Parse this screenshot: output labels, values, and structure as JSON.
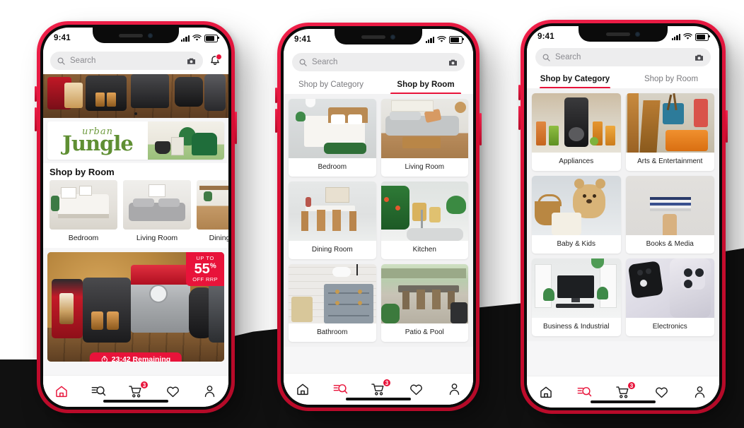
{
  "meta": {
    "accent_red": "#e8133a",
    "bg_top": "#ffffff",
    "bg_bottom": "#111111"
  },
  "status_bar": {
    "time": "9:41",
    "signal_icon": "cellular-signal-icon",
    "wifi_icon": "wifi-icon",
    "battery_icon": "battery-icon"
  },
  "search": {
    "placeholder": "Search",
    "search_icon": "search-icon",
    "camera_icon": "camera-icon",
    "bell_icon": "bell-icon"
  },
  "tabs": {
    "category_label": "Shop by Category",
    "room_label": "Shop by Room"
  },
  "nav": {
    "home_label": "Home",
    "home_icon": "home-icon",
    "search_label": "Search",
    "search_icon": "filter-search-icon",
    "cart_label": "Cart",
    "cart_icon": "cart-icon",
    "cart_badge": "3",
    "wishlist_label": "Wishlist",
    "wishlist_icon": "heart-icon",
    "account_label": "Account",
    "account_icon": "person-icon"
  },
  "phone1": {
    "banner": {
      "urban": "urban",
      "jungle": "Jungle"
    },
    "section_title": "Shop by Room",
    "rooms": [
      {
        "label": "Bedroom"
      },
      {
        "label": "Living Room"
      },
      {
        "label": "Dining Room"
      }
    ],
    "promo": {
      "badge_upto": "UP TO",
      "badge_percent": "55",
      "badge_percent_sign": "%",
      "badge_off": "OFF RRP",
      "timer_icon": "timer-icon",
      "timer_text": "23:42 Remaining"
    },
    "active_tab": "none",
    "active_nav": "home"
  },
  "phone2": {
    "active_tab": "Shop by Room",
    "active_nav": "search",
    "cards": [
      {
        "label": "Bedroom"
      },
      {
        "label": "Living Room"
      },
      {
        "label": "Dining Room"
      },
      {
        "label": "Kitchen"
      },
      {
        "label": "Bathroom"
      },
      {
        "label": "Patio & Pool"
      }
    ]
  },
  "phone3": {
    "active_tab": "Shop by Category",
    "active_nav": "search",
    "cards": [
      {
        "label": "Appliances"
      },
      {
        "label": "Arts & Entertainment"
      },
      {
        "label": "Baby & Kids"
      },
      {
        "label": "Books & Media"
      },
      {
        "label": "Business & Industrial"
      },
      {
        "label": "Electronics"
      }
    ]
  }
}
